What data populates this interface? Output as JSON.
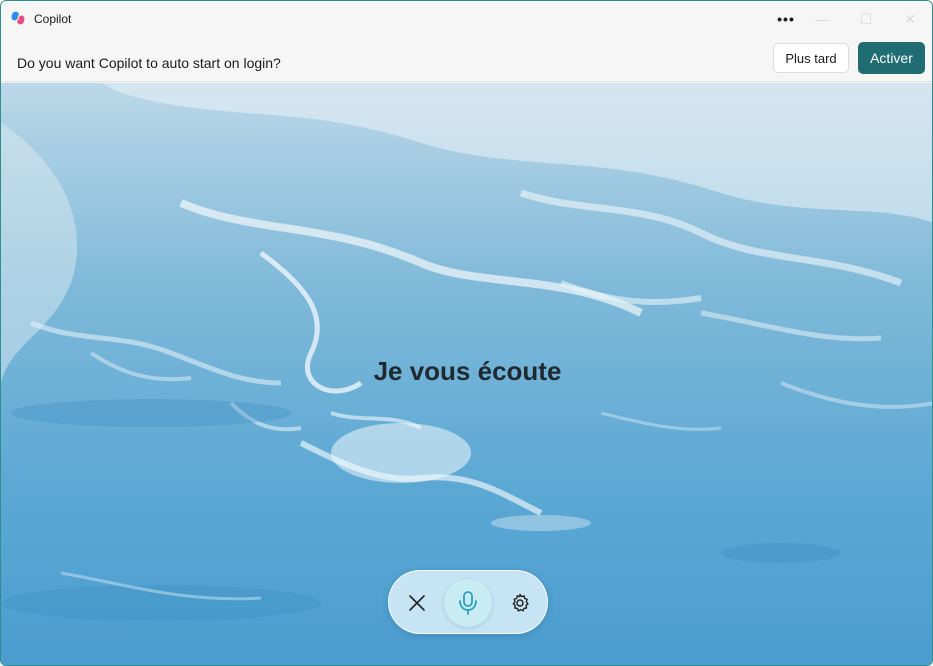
{
  "window": {
    "title": "Copilot",
    "more_icon": "more-horizontal-icon"
  },
  "notification": {
    "message": "Do you want Copilot to auto start on login?",
    "later_label": "Plus tard",
    "activate_label": "Activer"
  },
  "main": {
    "status_text": "Je vous écoute",
    "controls": {
      "close_icon": "close-icon",
      "mic_icon": "microphone-icon",
      "settings_icon": "gear-icon"
    }
  },
  "colors": {
    "accent": "#1f6c73",
    "mic_active": "#2aa1c0",
    "water": "#5aa6d2"
  }
}
